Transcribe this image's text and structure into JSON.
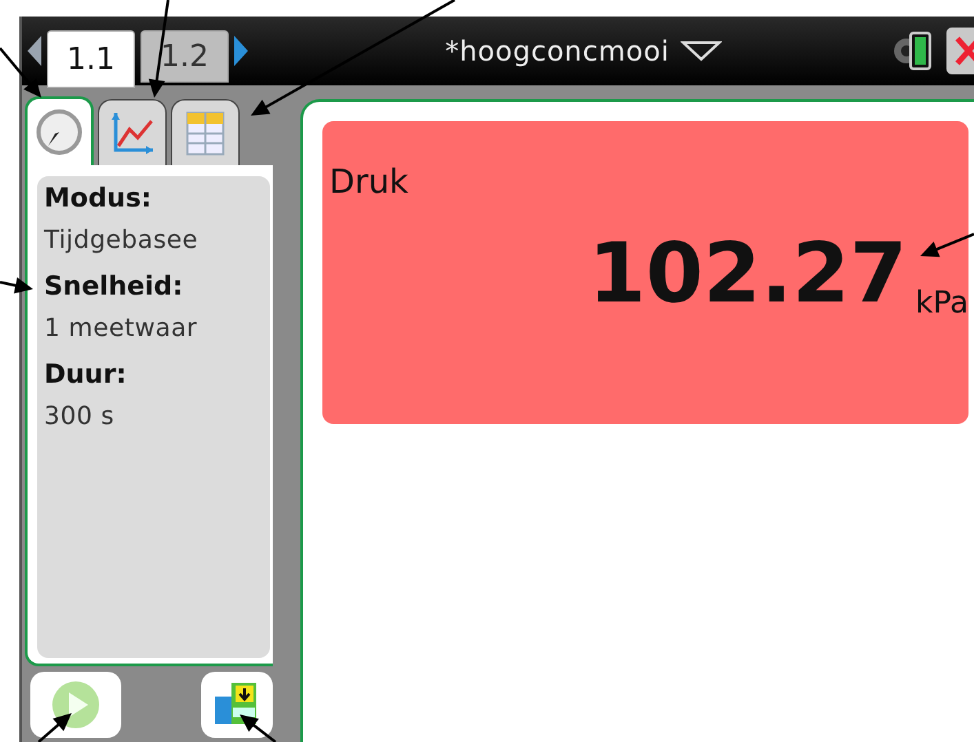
{
  "page_tabs": [
    {
      "label": "1.1",
      "selected": true
    },
    {
      "label": "1.2",
      "selected": false
    }
  ],
  "document": {
    "title": "*hoogconcmooi"
  },
  "app_tabs": [
    {
      "kind": "meter",
      "selected": true
    },
    {
      "kind": "graph",
      "selected": false
    },
    {
      "kind": "table",
      "selected": false
    }
  ],
  "settings": [
    {
      "label": "Modus:",
      "value": "Tijdgebasee"
    },
    {
      "label": "Snelheid:",
      "value": "1 meetwaar"
    },
    {
      "label": "Duur:",
      "value": "300 s"
    }
  ],
  "meter": {
    "label": "Druk",
    "value": "102.27",
    "unit": "kPa"
  },
  "buttons": [
    {
      "kind": "start"
    },
    {
      "kind": "store"
    }
  ]
}
